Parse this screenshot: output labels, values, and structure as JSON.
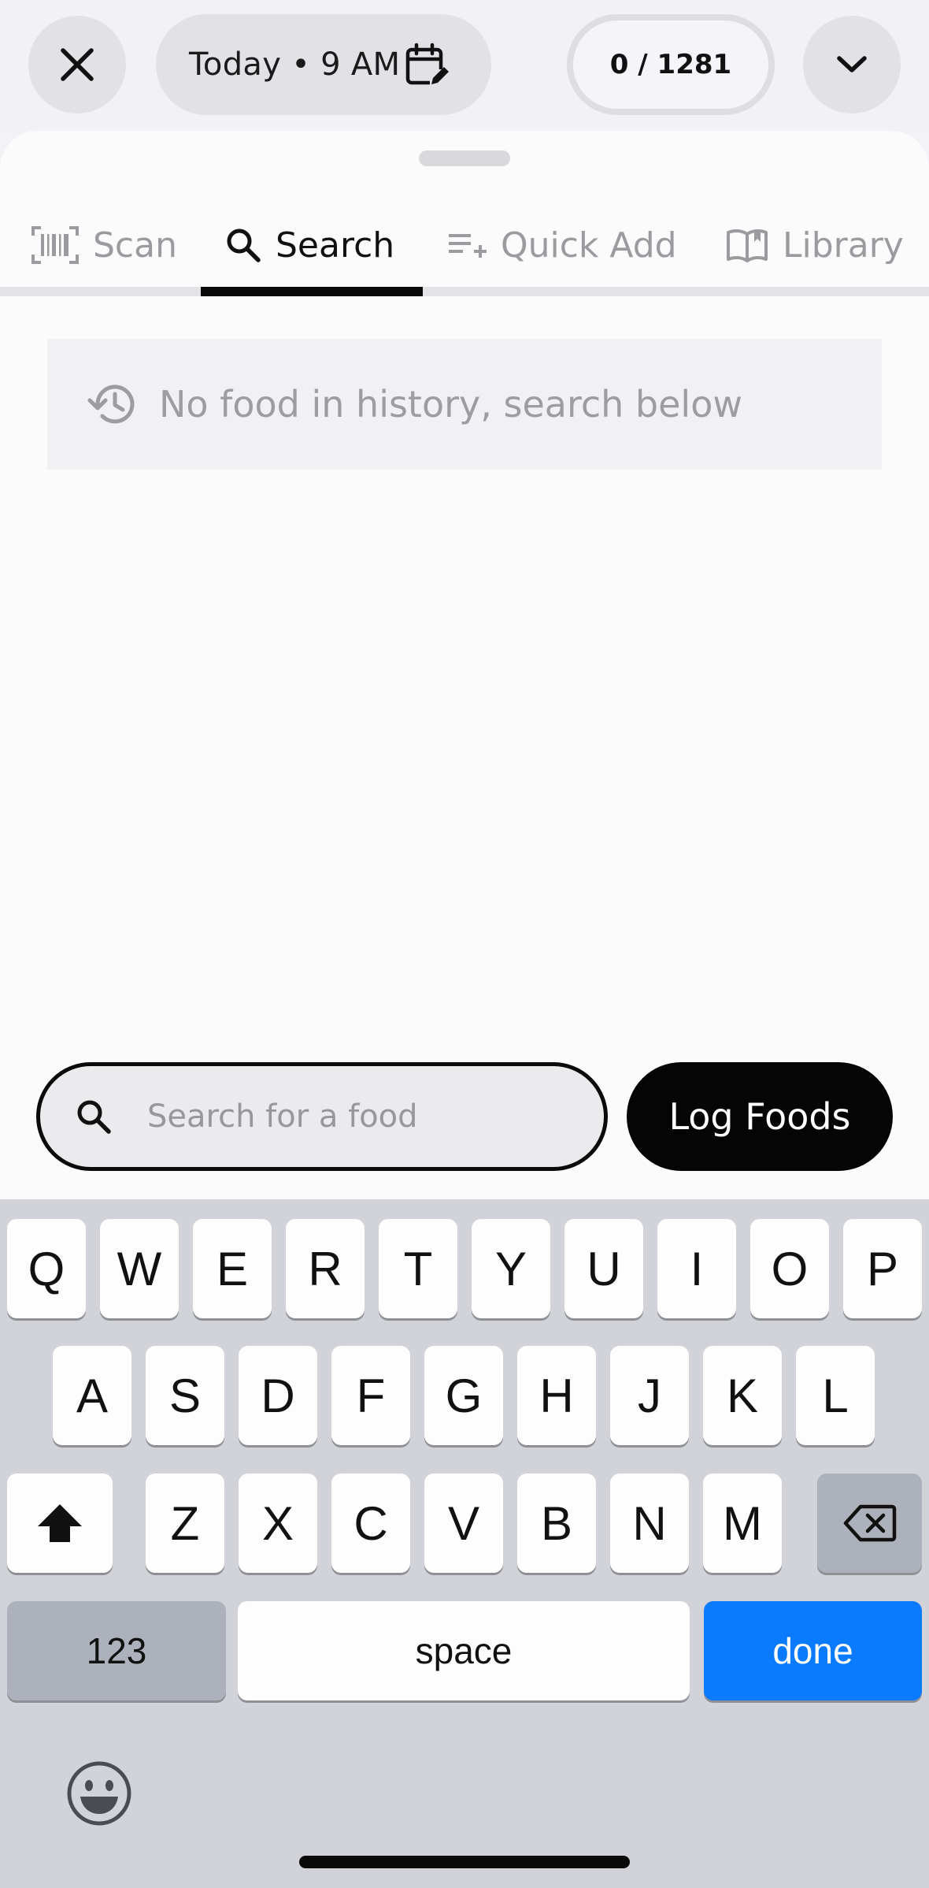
{
  "header": {
    "close_icon": "close-icon",
    "date_time": "Today • 9 AM",
    "calendar_icon": "calendar-edit-icon",
    "counter": "0 / 1281",
    "collapse_icon": "chevron-down-icon"
  },
  "tabs": [
    {
      "label": "Scan",
      "icon": "barcode-icon",
      "active": false
    },
    {
      "label": "Search",
      "icon": "search-icon",
      "active": true
    },
    {
      "label": "Quick Add",
      "icon": "playlist-add-icon",
      "active": false
    },
    {
      "label": "Library",
      "icon": "book-open-icon",
      "active": false
    }
  ],
  "history": {
    "message": "No food in history, search below",
    "icon": "history-icon"
  },
  "search": {
    "placeholder": "Search for a food",
    "value": ""
  },
  "log_button": "Log Foods",
  "keyboard": {
    "row1": [
      "Q",
      "W",
      "E",
      "R",
      "T",
      "Y",
      "U",
      "I",
      "O",
      "P"
    ],
    "row2": [
      "A",
      "S",
      "D",
      "F",
      "G",
      "H",
      "J",
      "K",
      "L"
    ],
    "row3": [
      "Z",
      "X",
      "C",
      "V",
      "B",
      "N",
      "M"
    ],
    "numbers_key": "123",
    "space_key": "space",
    "done_key": "done",
    "shift_icon": "shift-icon",
    "backspace_icon": "backspace-icon",
    "emoji_icon": "emoji-icon"
  },
  "colors": {
    "accent_blue": "#0a7aff",
    "primary_black": "#050505",
    "muted_text": "#9c9ca1"
  }
}
